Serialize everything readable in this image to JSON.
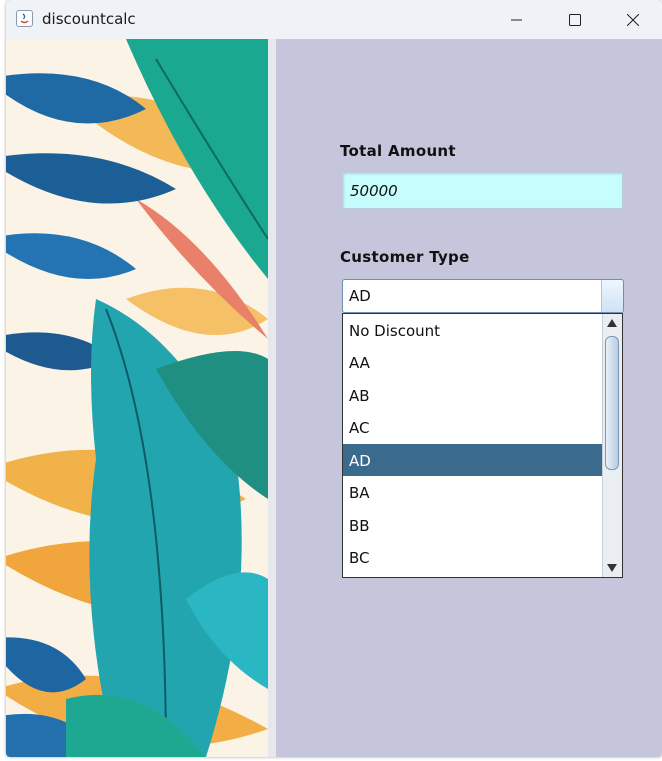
{
  "window": {
    "title": "discountcalc",
    "controls": {
      "minimize": "minimize-icon",
      "maximize": "maximize-icon",
      "close": "close-icon"
    }
  },
  "form": {
    "total_amount_label": "Total Amount",
    "total_amount_value": "50000",
    "customer_type_label": "Customer Type",
    "customer_type_selected": "AD"
  },
  "dropdown": {
    "options": [
      "No Discount",
      "AA",
      "AB",
      "AC",
      "AD",
      "BA",
      "BB",
      "BC"
    ],
    "selected_index": 4
  },
  "colors": {
    "right_panel_bg": "#c5c5dc",
    "amount_field_bg": "#c8fdfd",
    "selection_bg": "#3a6b8c"
  }
}
